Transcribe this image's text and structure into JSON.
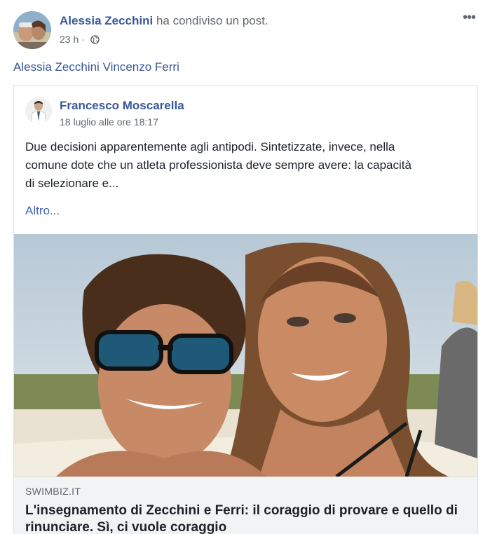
{
  "header": {
    "author_name": "Alessia Zecchini",
    "action_text": "ha condiviso un post.",
    "timestamp": "23 h",
    "separator": "·",
    "privacy_icon": "globe-icon",
    "more_icon": "more-options-icon",
    "more_label": "•••"
  },
  "tagged": {
    "people": [
      "Alessia Zecchini",
      "Vincenzo Ferri"
    ]
  },
  "shared_post": {
    "author_name": "Francesco Moscarella",
    "date": "18 luglio alle ore 18:17",
    "text_lines": [
      "Due decisioni apparentemente agli antipodi. Sintetizzate, invece, nella",
      "comune dote che un atleta professionista deve sempre avere: la capacità",
      "di selezionare e..."
    ],
    "more_link": "Altro..."
  },
  "link_preview": {
    "domain": "SWIMBIZ.IT",
    "title": "L'insegnamento di Zecchini e Ferri: il coraggio di provare e quello di rinunciare. Sì, ci vuole coraggio"
  },
  "colors": {
    "link_blue": "#385898",
    "secondary_text": "#606770",
    "border": "#dddfe2",
    "footer_bg": "#f2f3f5"
  }
}
